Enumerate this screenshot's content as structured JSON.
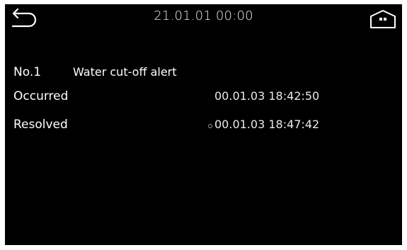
{
  "header": {
    "datetime": "21.01.01 00:00",
    "back_icon": "back-arrow-icon",
    "home_icon": "home-icon"
  },
  "alert": {
    "number": "No.1",
    "name": "Water cut-off alert"
  },
  "details": {
    "occurred_label": "Occurred",
    "occurred_value": "00.01.03 18:42:50",
    "resolved_label": "Resolved",
    "resolved_value": "00.01.03 18:47:42"
  },
  "colors": {
    "background": "#000000",
    "text": "#ffffff"
  }
}
